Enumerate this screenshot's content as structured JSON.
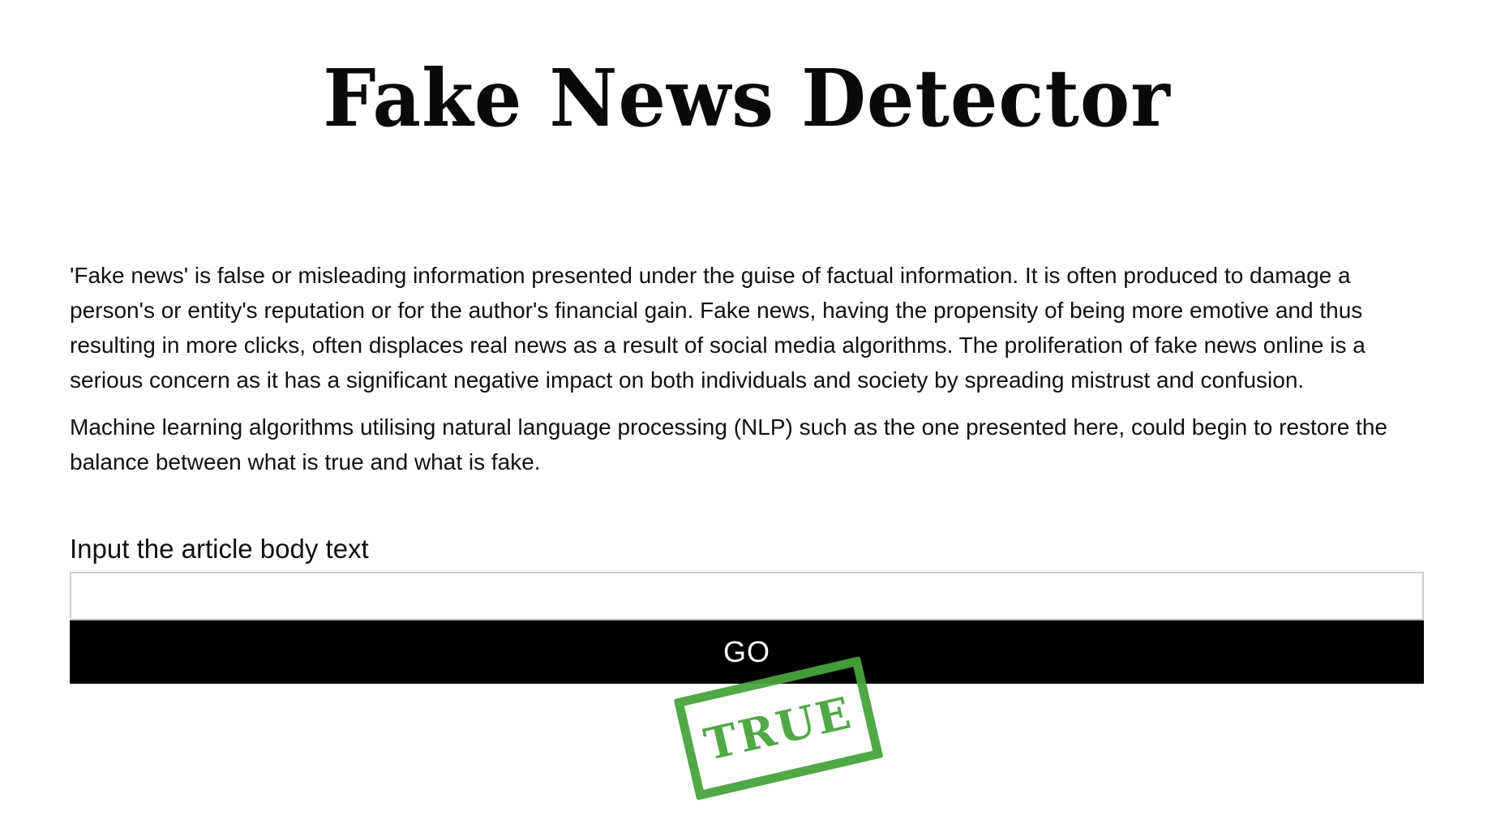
{
  "header": {
    "title": "Fake News Detector"
  },
  "intro": {
    "paragraph_1": "'Fake news' is false or misleading information presented under the guise of factual information. It is often produced to damage a person's or entity's reputation or for the author's financial gain. Fake news, having the propensity of being more emotive and thus resulting in more clicks, often displaces real news as a result of social media algorithms. The proliferation of fake news online is a serious concern as it has a significant negative impact on both individuals and society by spreading mistrust and confusion.",
    "paragraph_2": "Machine learning algorithms utilising natural language processing (NLP) such as the one presented here, could begin to restore the balance between what is true and what is fake."
  },
  "form": {
    "input_label": "Input the article body text",
    "input_value": "",
    "go_label": "GO"
  },
  "result": {
    "stamp_text": "TRUE",
    "stamp_color": "#47a53d"
  },
  "colors": {
    "button_background": "#000000",
    "button_text": "#ffffff",
    "page_background": "#ffffff"
  }
}
